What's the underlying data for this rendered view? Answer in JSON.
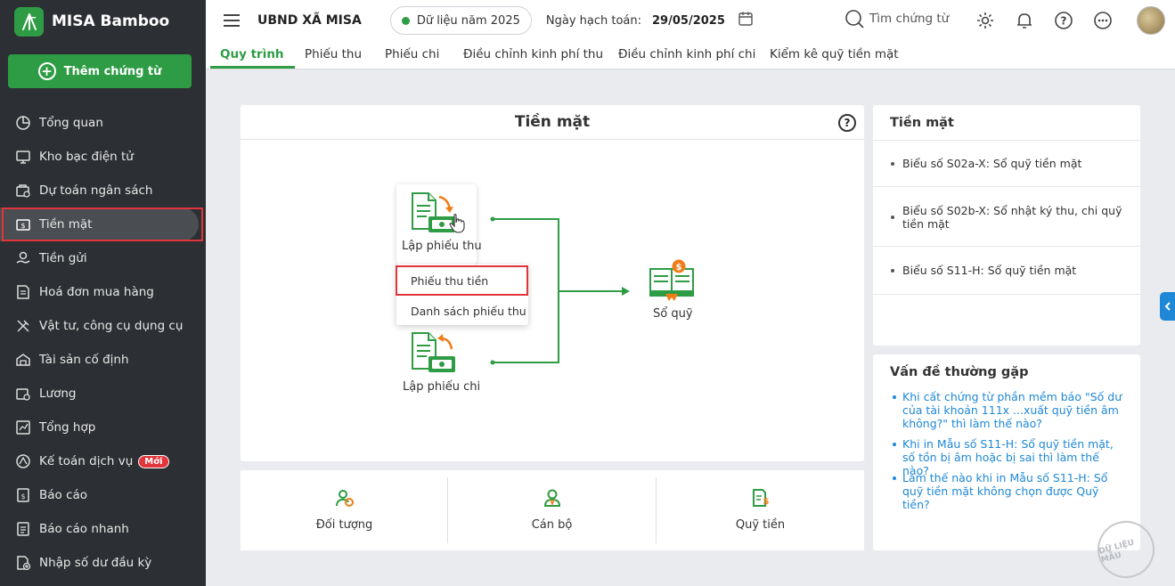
{
  "brand": {
    "name": "MISA Bamboo"
  },
  "sidebar": {
    "add_button": "Thêm chứng từ",
    "items": [
      {
        "label": "Tổng quan",
        "icon": "pie-chart-icon"
      },
      {
        "label": "Kho bạc điện tử",
        "icon": "monitor-icon"
      },
      {
        "label": "Dự toán ngân sách",
        "icon": "budget-icon"
      },
      {
        "label": "Tiền mặt",
        "icon": "cash-icon"
      },
      {
        "label": "Tiền gửi",
        "icon": "deposit-icon"
      },
      {
        "label": "Hoá đơn mua hàng",
        "icon": "invoice-icon"
      },
      {
        "label": "Vật tư, công cụ dụng cụ",
        "icon": "tools-icon"
      },
      {
        "label": "Tài sản cố định",
        "icon": "building-icon"
      },
      {
        "label": "Lương",
        "icon": "salary-icon"
      },
      {
        "label": "Tổng hợp",
        "icon": "summary-icon"
      },
      {
        "label": "Kế toán dịch vụ",
        "icon": "service-icon",
        "badge": "Mới"
      },
      {
        "label": "Báo cáo",
        "icon": "report-icon"
      },
      {
        "label": "Báo cáo nhanh",
        "icon": "quick-report-icon"
      },
      {
        "label": "Nhập số dư đầu kỳ",
        "icon": "opening-balance-icon"
      }
    ]
  },
  "header": {
    "org": "UBND XÃ MISA",
    "data_year": "Dữ liệu năm 2025",
    "post_date_label": "Ngày hạch toán:",
    "post_date": "29/05/2025",
    "search_label": "Tìm chứng từ"
  },
  "tabs": [
    "Quy trình",
    "Phiếu thu",
    "Phiếu chi",
    "Điều chỉnh kinh phí thu",
    "Điều chỉnh kinh phí chi",
    "Kiểm kê quỹ tiền mặt"
  ],
  "main": {
    "title": "Tiền mặt",
    "flow": {
      "receipt_label": "Lập phiếu thu",
      "payment_label": "Lập phiếu chi",
      "ledger_label": "Sổ quỹ"
    },
    "dropdown": [
      "Phiếu thu tiền",
      "Danh sách phiếu thu"
    ],
    "quick_links": [
      "Đối tượng",
      "Cán bộ",
      "Quỹ tiền"
    ]
  },
  "right_panel": {
    "title": "Tiền mặt",
    "reports": [
      "Biểu số S02a-X: Sổ quỹ tiền mặt",
      "Biểu số S02b-X: Sổ nhật ký thu, chi quỹ tiền mặt",
      "Biểu số S11-H: Sổ quỹ tiền mặt"
    ],
    "faq_title": "Vấn đề thường gặp",
    "faq": [
      "Khi cất chứng từ phần mềm báo \"Số dư của tài khoản 111x ...xuất quỹ tiền âm không?\" thì làm thế nào?",
      "Khi in Mẫu số S11-H: Sổ quỹ tiền mặt, số tồn bị âm hoặc bị sai thì làm thế nào?",
      "Làm thế nào khi in Mẫu số S11-H: Sổ quỹ tiền mặt không chọn được Quỹ tiền?"
    ]
  },
  "watermark": "DỮ LIỆU MẪU",
  "colors": {
    "brand_green": "#2e9c44",
    "sidebar_bg": "#2c2f33",
    "highlight_red": "#e0353b",
    "link_blue": "#1e88d6"
  }
}
